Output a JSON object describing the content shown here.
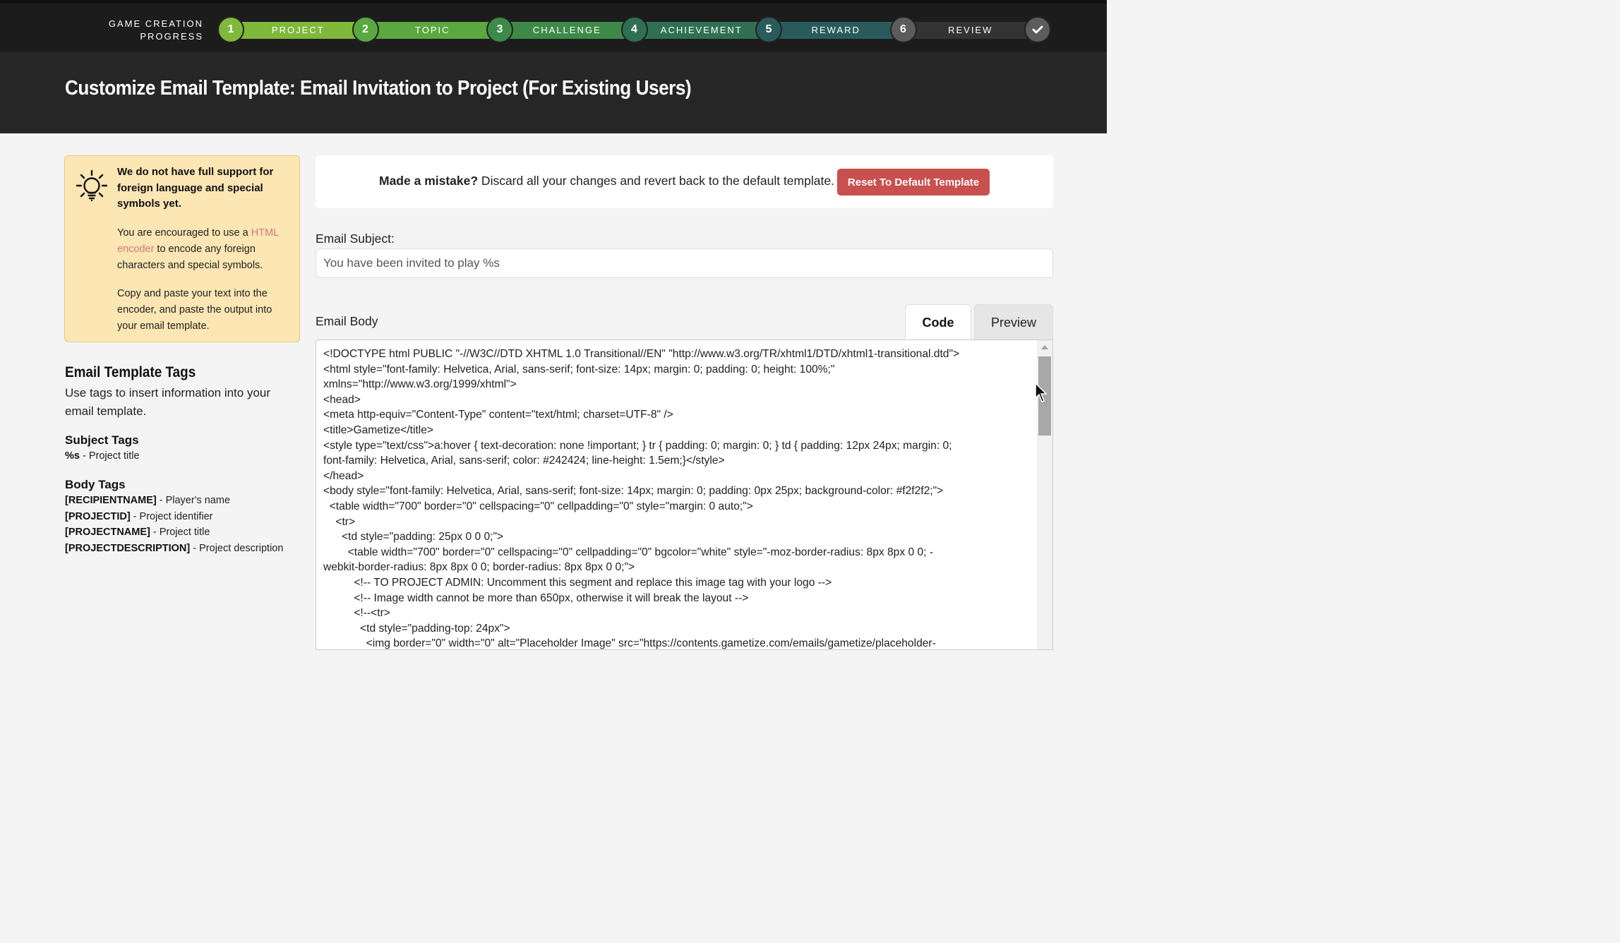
{
  "progress": {
    "label_line1": "GAME CREATION",
    "label_line2": "PROGRESS",
    "steps": [
      {
        "number": "1",
        "label": "PROJECT",
        "circle_color": "#7fb83a",
        "bar_color": "#7fb83a"
      },
      {
        "number": "2",
        "label": "TOPIC",
        "circle_color": "#5aa83f",
        "bar_color": "#5aa83f"
      },
      {
        "number": "3",
        "label": "CHALLENGE",
        "circle_color": "#3d8a48",
        "bar_color": "#3d8a48"
      },
      {
        "number": "4",
        "label": "ACHIEVEMENT",
        "circle_color": "#2f7055",
        "bar_color": "#2f7055"
      },
      {
        "number": "5",
        "label": "REWARD",
        "circle_color": "#2a5b5c",
        "bar_color": "#2a5b5c"
      },
      {
        "number": "6",
        "label": "REVIEW",
        "circle_color": "#5c5c5c",
        "bar_color": "#333333"
      }
    ],
    "final_icon": "checkmark-icon"
  },
  "page": {
    "title": "Customize Email Template: Email Invitation to Project (For Existing Users)"
  },
  "notice": {
    "icon": "lightbulb-icon",
    "title": "We do not have full support for foreign language and special symbols yet.",
    "p1_before": "You are encouraged to use a ",
    "p1_link": "HTML encoder",
    "p1_after": " to encode any foreign characters and special symbols.",
    "p2": "Copy and paste your text into the encoder, and paste the output into your email template."
  },
  "tags": {
    "title": "Email Template Tags",
    "description": "Use tags to insert information into your email template.",
    "subject_heading": "Subject Tags",
    "subject_tags": [
      {
        "tag": "%s",
        "desc": " - Project title"
      }
    ],
    "body_heading": "Body Tags",
    "body_tags": [
      {
        "tag": "[RECIPIENTNAME]",
        "desc": " - Player's name"
      },
      {
        "tag": "[PROJECTID]",
        "desc": " - Project identifier"
      },
      {
        "tag": "[PROJECTNAME]",
        "desc": " - Project title"
      },
      {
        "tag": "[PROJECTDESCRIPTION]",
        "desc": " - Project description"
      }
    ]
  },
  "mistake": {
    "bold": "Made a mistake?",
    "text": " Discard all your changes and revert back to the default template.",
    "button": "Reset To Default Template"
  },
  "subject": {
    "label": "Email Subject:",
    "value": "You have been invited to play %s"
  },
  "body": {
    "label": "Email Body",
    "tab_code": "Code",
    "tab_preview": "Preview",
    "code": "<!DOCTYPE html PUBLIC \"-//W3C//DTD XHTML 1.0 Transitional//EN\" \"http://www.w3.org/TR/xhtml1/DTD/xhtml1-transitional.dtd\">\n<html style=\"font-family: Helvetica, Arial, sans-serif; font-size: 14px; margin: 0; padding: 0; height: 100%;\"\nxmlns=\"http://www.w3.org/1999/xhtml\">\n<head>\n<meta http-equiv=\"Content-Type\" content=\"text/html; charset=UTF-8\" />\n<title>Gametize</title>\n<style type=\"text/css\">a:hover { text-decoration: none !important; } tr { padding: 0; margin: 0; } td { padding: 12px 24px; margin: 0;\nfont-family: Helvetica, Arial, sans-serif; color: #242424; line-height: 1.5em;}</style>\n</head>\n<body style=\"font-family: Helvetica, Arial, sans-serif; font-size: 14px; margin: 0; padding: 0px 25px; background-color: #f2f2f2;\">\n  <table width=\"700\" border=\"0\" cellspacing=\"0\" cellpadding=\"0\" style=\"margin: 0 auto;\">\n    <tr>\n      <td style=\"padding: 25px 0 0 0;\">\n        <table width=\"700\" border=\"0\" cellspacing=\"0\" cellpadding=\"0\" bgcolor=\"white\" style=\"-moz-border-radius: 8px 8px 0 0; -\nwebkit-border-radius: 8px 8px 0 0; border-radius: 8px 8px 0 0;\">\n          <!-- TO PROJECT ADMIN: Uncomment this segment and replace this image tag with your logo -->\n          <!-- Image width cannot be more than 650px, otherwise it will break the layout -->\n          <!--<tr>\n            <td style=\"padding-top: 24px\">\n              <img border=\"0\" width=\"0\" alt=\"Placeholder Image\" src=\"https://contents.gametize.com/emails/gametize/placeholder-"
  }
}
